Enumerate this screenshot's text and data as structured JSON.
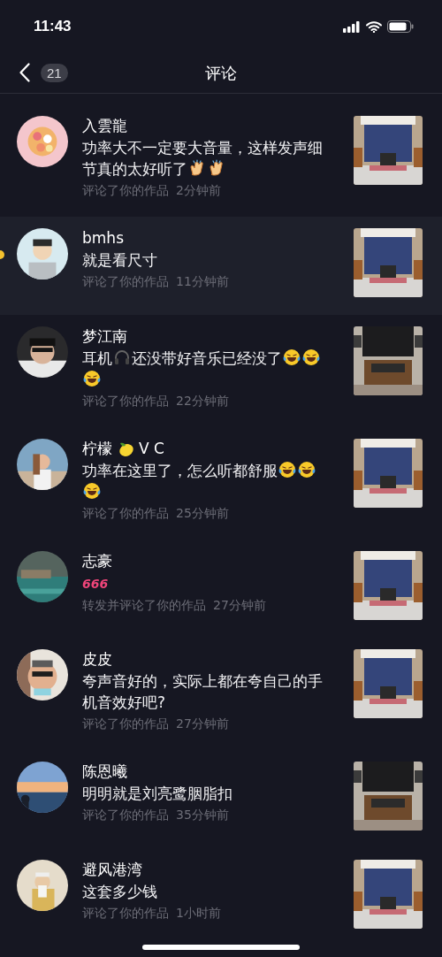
{
  "status_bar": {
    "time": "11:43"
  },
  "nav": {
    "badge": "21",
    "title": "评论"
  },
  "comments": [
    {
      "highlighted": false,
      "name": [
        {
          "kind": "text",
          "text": "入雲龍"
        }
      ],
      "body": [
        {
          "kind": "text",
          "text": "功率大不一定要大音量，这样发声细"
        },
        {
          "kind": "text",
          "text": "节真的太好听了"
        },
        {
          "kind": "clap"
        },
        {
          "kind": "clap"
        }
      ],
      "action": "评论了你的作品",
      "time": "2分钟前"
    },
    {
      "highlighted": true,
      "name": [
        {
          "kind": "text",
          "text": "bmhs"
        }
      ],
      "body": [
        {
          "kind": "text",
          "text": "就是看尺寸"
        }
      ],
      "action": "评论了你的作品",
      "time": "11分钟前"
    },
    {
      "highlighted": false,
      "name": [
        {
          "kind": "text",
          "text": "梦江南"
        }
      ],
      "body": [
        {
          "kind": "text",
          "text": "耳机"
        },
        {
          "kind": "headphones"
        },
        {
          "kind": "text",
          "text": "还没带好音乐已经没了"
        },
        {
          "kind": "laugh"
        },
        {
          "kind": "laugh"
        },
        {
          "kind": "laugh"
        }
      ],
      "action": "评论了你的作品",
      "time": "22分钟前"
    },
    {
      "highlighted": false,
      "name": [
        {
          "kind": "text",
          "text": "柠檬"
        },
        {
          "kind": "lemon"
        },
        {
          "kind": "text",
          "text": "V C"
        }
      ],
      "body": [
        {
          "kind": "text",
          "text": "功率在这里了，怎么听都舒服"
        },
        {
          "kind": "laugh"
        },
        {
          "kind": "laugh"
        },
        {
          "kind": "laugh"
        }
      ],
      "action": "评论了你的作品",
      "time": "25分钟前"
    },
    {
      "highlighted": false,
      "name": [
        {
          "kind": "text",
          "text": "志豪"
        }
      ],
      "body": [
        {
          "kind": "sticker",
          "text": "666"
        }
      ],
      "action": "转发并评论了你的作品",
      "time": "27分钟前"
    },
    {
      "highlighted": false,
      "name": [
        {
          "kind": "text",
          "text": "皮皮"
        }
      ],
      "body": [
        {
          "kind": "text",
          "text": "夸声音好的，实际上都在夸自己的手机音效好吧?"
        }
      ],
      "action": "评论了你的作品",
      "time": "27分钟前"
    },
    {
      "highlighted": false,
      "name": [
        {
          "kind": "text",
          "text": "陈恩曦"
        }
      ],
      "body": [
        {
          "kind": "text",
          "text": "明明就是刘亮鹭胭脂扣"
        }
      ],
      "action": "评论了你的作品",
      "time": "35分钟前"
    },
    {
      "highlighted": false,
      "name": [
        {
          "kind": "text",
          "text": "避风港湾"
        }
      ],
      "body": [
        {
          "kind": "text",
          "text": "这套多少钱"
        }
      ],
      "action": "评论了你的作品",
      "time": "1小时前"
    }
  ]
}
